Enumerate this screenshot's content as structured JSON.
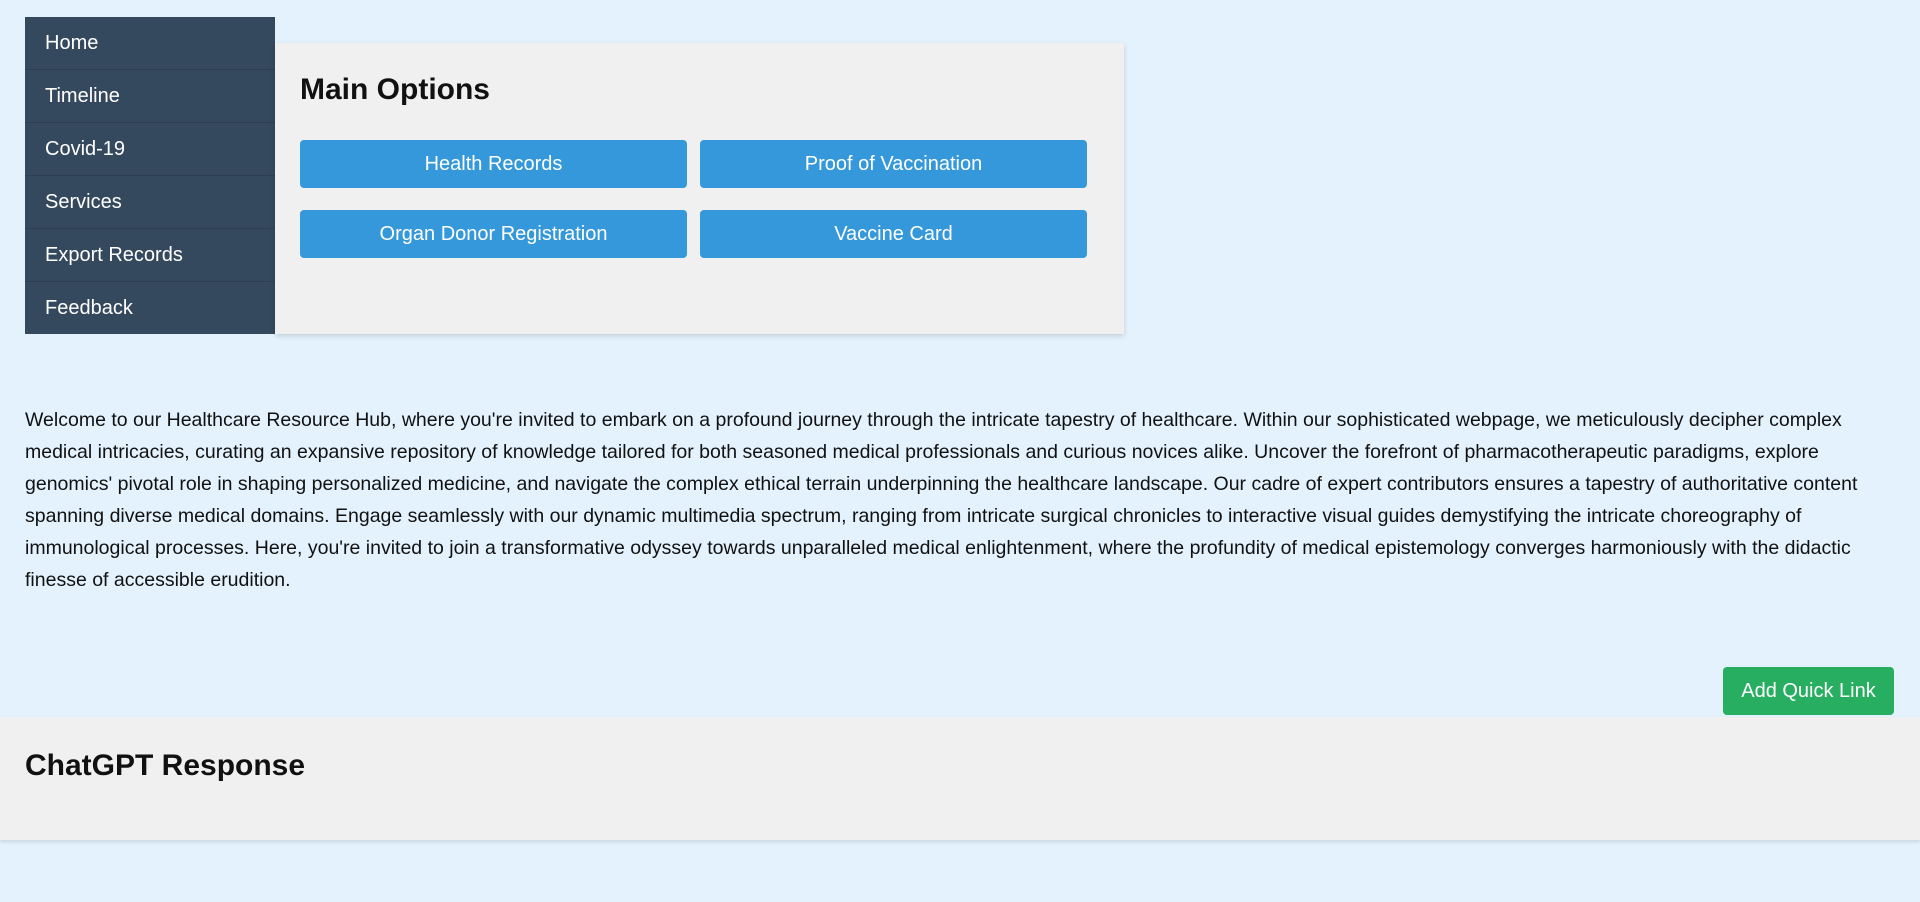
{
  "sidebar": {
    "items": [
      {
        "label": "Home"
      },
      {
        "label": "Timeline"
      },
      {
        "label": "Covid-19"
      },
      {
        "label": "Services"
      },
      {
        "label": "Export Records"
      },
      {
        "label": "Feedback"
      }
    ]
  },
  "main_options": {
    "title": "Main Options",
    "buttons": [
      {
        "label": "Health Records"
      },
      {
        "label": "Proof of Vaccination"
      },
      {
        "label": "Organ Donor Registration"
      },
      {
        "label": "Vaccine Card"
      }
    ]
  },
  "intro": {
    "text": "Welcome to our Healthcare Resource Hub, where you're invited to embark on a profound journey through the intricate tapestry of healthcare. Within our sophisticated webpage, we meticulously decipher complex medical intricacies, curating an expansive repository of knowledge tailored for both seasoned medical professionals and curious novices alike. Uncover the forefront of pharmacotherapeutic paradigms, explore genomics' pivotal role in shaping personalized medicine, and navigate the complex ethical terrain underpinning the healthcare landscape. Our cadre of expert contributors ensures a tapestry of authoritative content spanning diverse medical domains. Engage seamlessly with our dynamic multimedia spectrum, ranging from intricate surgical chronicles to interactive visual guides demystifying the intricate choreography of immunological processes. Here, you're invited to join a transformative odyssey towards unparalleled medical enlightenment, where the profundity of medical epistemology converges harmoniously with the didactic finesse of accessible erudition."
  },
  "quick_link": {
    "label": "Add Quick Link"
  },
  "response": {
    "title": "ChatGPT Response"
  },
  "colors": {
    "page_background": "#e3f2fd",
    "sidebar_background": "#34495e",
    "panel_background": "#f0f0f0",
    "option_button": "#3498db",
    "quick_link_button": "#27ae60"
  }
}
